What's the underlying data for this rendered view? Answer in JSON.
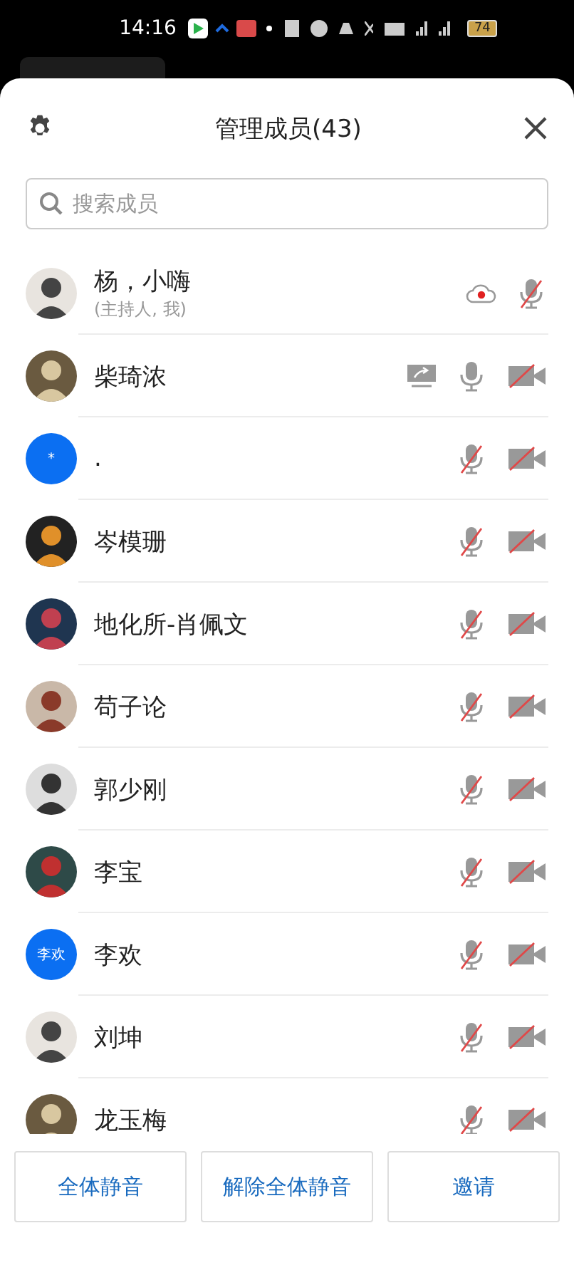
{
  "status_bar": {
    "time": "14:16",
    "battery": "74"
  },
  "header": {
    "title": "管理成员(43)"
  },
  "search": {
    "placeholder": "搜索成员"
  },
  "members": [
    {
      "name": "杨，小嗨",
      "subtitle": "(主持人, 我)",
      "recording": true,
      "sharing": false,
      "mic_muted": true
    },
    {
      "name": "柴琦浓",
      "recording": false,
      "sharing": true,
      "mic_muted": false,
      "video_on": false
    },
    {
      "name": ".",
      "avatar": {
        "kind": "initials",
        "text": "*"
      },
      "recording": false,
      "sharing": false,
      "mic_muted": true,
      "video_on": false
    },
    {
      "name": "岑模珊",
      "recording": false,
      "sharing": false,
      "mic_muted": true,
      "video_on": false
    },
    {
      "name": "地化所-肖佩文",
      "recording": false,
      "sharing": false,
      "mic_muted": true,
      "video_on": false
    },
    {
      "name": "苟子论",
      "recording": false,
      "sharing": false,
      "mic_muted": true,
      "video_on": false
    },
    {
      "name": "郭少刚",
      "recording": false,
      "sharing": false,
      "mic_muted": true,
      "video_on": false
    },
    {
      "name": "李宝",
      "recording": false,
      "sharing": false,
      "mic_muted": true,
      "video_on": false
    },
    {
      "name": "李欢",
      "avatar": {
        "kind": "initials",
        "text": "李欢"
      },
      "recording": false,
      "sharing": false,
      "mic_muted": true,
      "video_on": false
    },
    {
      "name": "刘坤",
      "recording": false,
      "sharing": false,
      "mic_muted": true,
      "video_on": false
    },
    {
      "name": "龙玉梅",
      "recording": false,
      "sharing": false,
      "mic_muted": true,
      "video_on": false
    }
  ],
  "buttons": [
    "全体静音",
    "解除全体静音",
    "邀请"
  ]
}
